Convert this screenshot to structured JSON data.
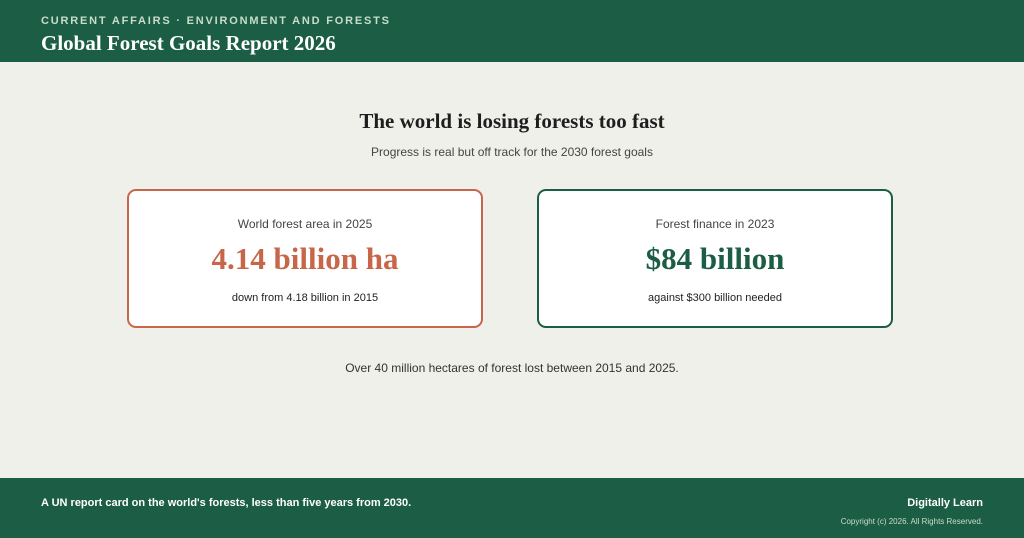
{
  "header": {
    "kicker": "CURRENT AFFAIRS · ENVIRONMENT AND FORESTS",
    "title": "Global Forest Goals Report 2026"
  },
  "main": {
    "headline": "The world is losing forests too fast",
    "subhead": "Progress is real but off track for the 2030 forest goals",
    "cards": [
      {
        "label": "World forest area in 2025",
        "value": "4.14 billion ha",
        "note": "down from 4.18 billion in 2015",
        "accent_color": "#c8664a"
      },
      {
        "label": "Forest finance in 2023",
        "value": "$84 billion",
        "note": "against $300 billion needed",
        "accent_color": "#1b5e45"
      }
    ],
    "loss_note": "Over 40 million hectares of forest lost between 2015 and 2025."
  },
  "footer": {
    "tagline": "A UN report card on the world's forests, less than five years from 2030.",
    "brand": "Digitally Learn",
    "copyright": "Copyright (c) 2026. All Rights Reserved."
  },
  "colors": {
    "brand_green": "#1b5e45",
    "accent_terracotta": "#c8664a",
    "background": "#f0f0ea"
  }
}
